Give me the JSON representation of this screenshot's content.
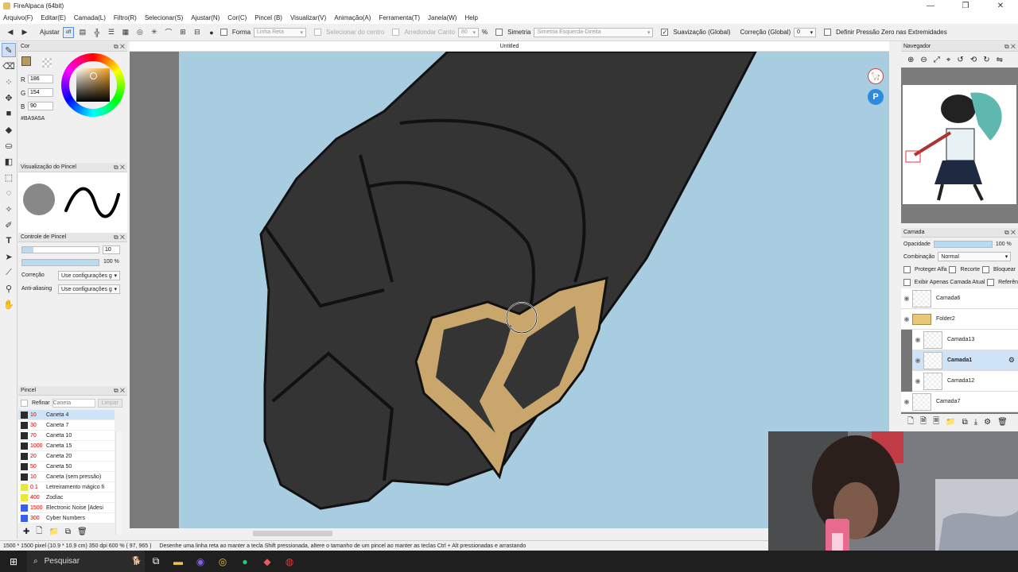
{
  "window": {
    "title": "FireAlpaca (64bit)",
    "minimize": "—",
    "maximize": "❐",
    "close": "✕"
  },
  "menu": [
    "Arquivo(F)",
    "Editar(E)",
    "Camada(L)",
    "Filtro(R)",
    "Selecionar(S)",
    "Ajustar(N)",
    "Cor(C)",
    "Pincel (B)",
    "Visualizar(V)",
    "Animação(A)",
    "Ferramenta(T)",
    "Janela(W)",
    "Help"
  ],
  "toolbar": {
    "ajustar": "Ajustar",
    "off": "off",
    "forma": "Forma",
    "linha_reta": "Linha Reta",
    "selecionar_centro": "Selecionar do centro",
    "arredondar_canto": "Arredondar Canto",
    "arredondar_value": "80",
    "percent": "%",
    "simetria": "Simetria",
    "simetria_value": "Simetria Esquerda-Direita",
    "suavizacao": "Suavização (Global)",
    "correcao": "Correção (Global)",
    "correcao_value": "0",
    "pressao": "Definir Pressão Zero nas Extremidades"
  },
  "color_panel": {
    "title": "Cor",
    "r_label": "R",
    "r": "186",
    "g_label": "G",
    "g": "154",
    "b_label": "B",
    "b": "90",
    "hex": "#BA9A5A",
    "primary": "#ba9a5a"
  },
  "brush_preview": {
    "title": "Visualização do Pincel"
  },
  "brush_control": {
    "title": "Controle de Pincel",
    "size": "10",
    "opacity": "100 %",
    "size_fill": 0.15,
    "opacity_fill": 1.0,
    "correcao_label": "Correção",
    "correcao_value": "Use configurações g",
    "aa_label": "Anti-aliasing",
    "aa_value": "Use configurações g"
  },
  "brush_panel": {
    "title": "Pincel",
    "refine": "Refinar",
    "search_placeholder": "Caneta",
    "clear": "Limpar",
    "items": [
      {
        "size": "10",
        "name": "Caneta 4",
        "color": "#2b2b2b"
      },
      {
        "size": "30",
        "name": "Caneta 7",
        "color": "#2b2b2b"
      },
      {
        "size": "70",
        "name": "Caneta 10",
        "color": "#2b2b2b"
      },
      {
        "size": "1000",
        "name": "Caneta 15",
        "color": "#2b2b2b"
      },
      {
        "size": "20",
        "name": "Caneta 20",
        "color": "#2b2b2b"
      },
      {
        "size": "50",
        "name": "Caneta 50",
        "color": "#2b2b2b"
      },
      {
        "size": "10",
        "name": "Caneta (sem pressão)",
        "color": "#2b2b2b"
      },
      {
        "size": "0.1",
        "name": "Letreiramento mágico fi",
        "color": "#e8e83a"
      },
      {
        "size": "400",
        "name": "Zodíac",
        "color": "#e8e83a"
      },
      {
        "size": "1500",
        "name": "Electronic Noise [Adesi",
        "color": "#3a5fe8"
      },
      {
        "size": "300",
        "name": "Cyber Numbers",
        "color": "#3a5fe8"
      }
    ]
  },
  "canvas": {
    "tab": "Untitled"
  },
  "navigator": {
    "title": "Navegador"
  },
  "layers": {
    "title": "Camada",
    "opacity_label": "Opacidade",
    "opacity": "100 %",
    "opacity_fill": 1.0,
    "blend_label": "Combinação",
    "blend": "Normal",
    "protect_alpha": "Proteger Alfa",
    "clip": "Recorte",
    "lock": "Bloquear",
    "show_current": "Exibir Apenas Camada Atual",
    "reference": "Referên",
    "items": [
      {
        "name": "Camada6",
        "selected": false,
        "indent": 0
      },
      {
        "name": "Folder2",
        "selected": false,
        "indent": 0
      },
      {
        "name": "Camada13",
        "selected": false,
        "indent": 1
      },
      {
        "name": "Camada1",
        "selected": true,
        "indent": 1
      },
      {
        "name": "Camada12",
        "selected": false,
        "indent": 1
      },
      {
        "name": "Camada7",
        "selected": false,
        "indent": 0
      }
    ]
  },
  "status": {
    "size": "1500 * 1500 pixel  (10.9 * 10.9 cm)  350 dpi  600 %  ( 97, 965 )",
    "hint": "Desenhe uma linha reta ao manter a tecla Shift pressionada, altere o tamanho de um pincel ao manter as teclas Ctrl + Alt pressionadas e arrastando"
  },
  "taskbar": {
    "search": "Pesquisar"
  }
}
